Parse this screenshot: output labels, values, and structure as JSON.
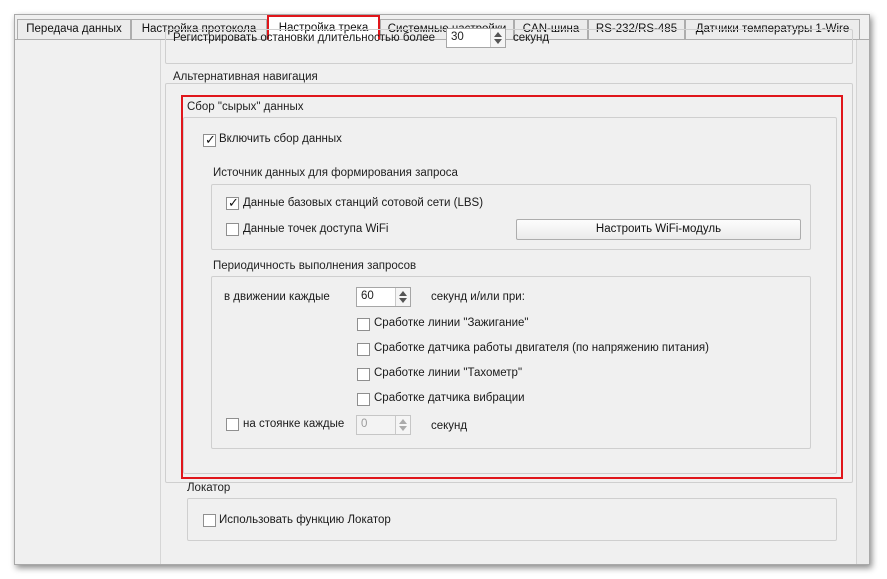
{
  "tabs": [
    {
      "label": "Передача данных"
    },
    {
      "label": "Настройка протокола"
    },
    {
      "label": "Настройка трека"
    },
    {
      "label": "Системные настройки"
    },
    {
      "label": "CAN-шина"
    },
    {
      "label": "RS-232/RS-485"
    },
    {
      "label": "Датчики температуры 1-Wire"
    }
  ],
  "active_tab": "Настройка трека",
  "top_partial": {
    "label": "Регистрировать остановки длительностью более",
    "value": "30",
    "unit": "секунд"
  },
  "alt_nav": {
    "title": "Альтернативная навигация",
    "raw": {
      "title": "Сбор \"сырых\" данных",
      "enable_label": "Включить сбор данных",
      "enable_checked": true,
      "source": {
        "title": "Источник данных для формирования запроса",
        "lbs_label": "Данные базовых станций сотовой сети (LBS)",
        "lbs_checked": true,
        "wifi_label": "Данные точек доступа WiFi",
        "wifi_checked": false,
        "wifi_button": "Настроить WiFi-модуль"
      },
      "period": {
        "title": "Периодичность выполнения запросов",
        "moving_label": "в движении каждые",
        "moving_value": "60",
        "moving_unit": "секунд и/или при:",
        "triggers": [
          {
            "label": "Сработке линии \"Зажигание\"",
            "checked": false
          },
          {
            "label": "Сработке датчика работы двигателя (по напряжению питания)",
            "checked": false
          },
          {
            "label": "Сработке линии \"Тахометр\"",
            "checked": false
          },
          {
            "label": "Сработке датчика вибрации",
            "checked": false
          }
        ],
        "parked_label": "на стоянке каждые",
        "parked_checked": false,
        "parked_value": "0",
        "parked_unit": "секунд"
      }
    }
  },
  "locator": {
    "title": "Локатор",
    "use_label": "Использовать функцию Локатор",
    "use_checked": false
  },
  "colors": {
    "highlight": "#e0161b",
    "panel_bg": "#f0f0f0"
  }
}
